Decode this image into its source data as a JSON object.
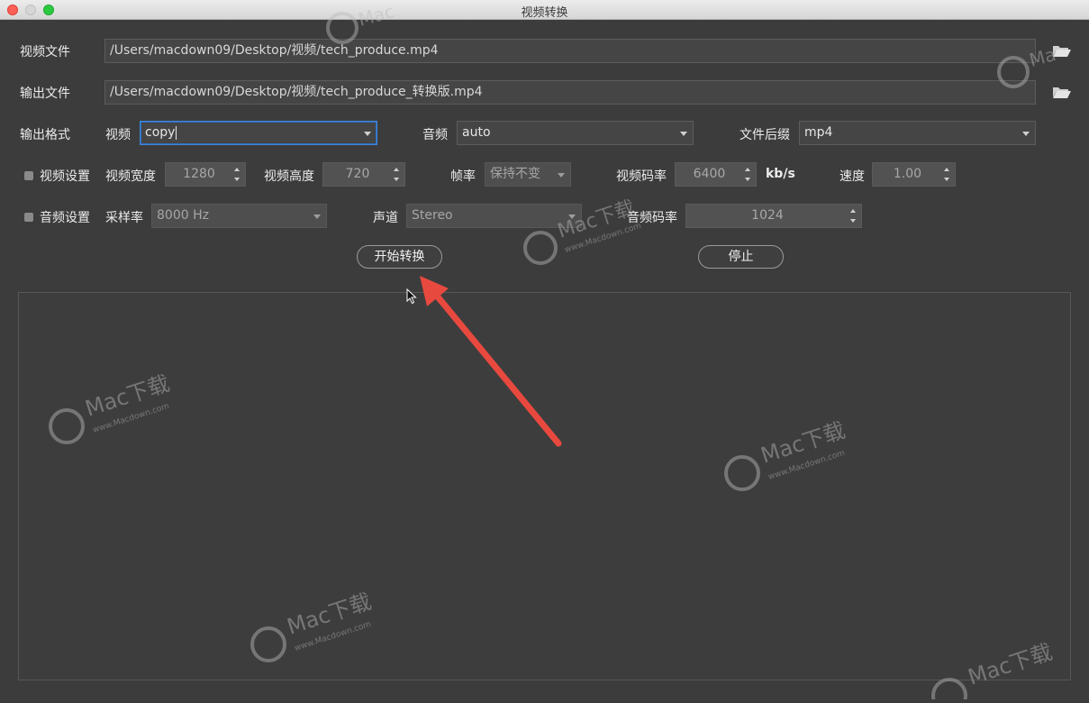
{
  "window": {
    "title": "视频转换"
  },
  "input_file": {
    "label": "视频文件",
    "value": "/Users/macdown09/Desktop/视频/tech_produce.mp4"
  },
  "output_file": {
    "label": "输出文件",
    "value": "/Users/macdown09/Desktop/视频/tech_produce_转换版.mp4"
  },
  "format": {
    "label": "输出格式",
    "video_label": "视频",
    "video_value": "copy",
    "audio_label": "音频",
    "audio_value": "auto",
    "suffix_label": "文件后缀",
    "suffix_value": "mp4"
  },
  "video_settings": {
    "label": "视频设置",
    "width_label": "视频宽度",
    "width_value": "1280",
    "height_label": "视频高度",
    "height_value": "720",
    "fps_label": "帧率",
    "fps_value": "保持不变",
    "bitrate_label": "视频码率",
    "bitrate_value": "6400",
    "bitrate_unit": "kb/s",
    "speed_label": "速度",
    "speed_value": "1.00"
  },
  "audio_settings": {
    "label": "音频设置",
    "samplerate_label": "采样率",
    "samplerate_value": "8000 Hz",
    "channel_label": "声道",
    "channel_value": "Stereo",
    "bitrate_label": "音频码率",
    "bitrate_value": "1024"
  },
  "actions": {
    "start_label": "开始转换",
    "stop_label": "停止"
  },
  "watermark": {
    "brand": "Mac下载",
    "site": "www.Macdown.com"
  },
  "colors": {
    "annotation_arrow": "#e8493f",
    "focus": "#3f87d8"
  },
  "icons": {
    "input_folder": "folder-open-icon",
    "output_folder": "folder-open-icon",
    "annotation": "red-arrow-annotation-icon",
    "mouse": "mouse-pointer-icon"
  }
}
